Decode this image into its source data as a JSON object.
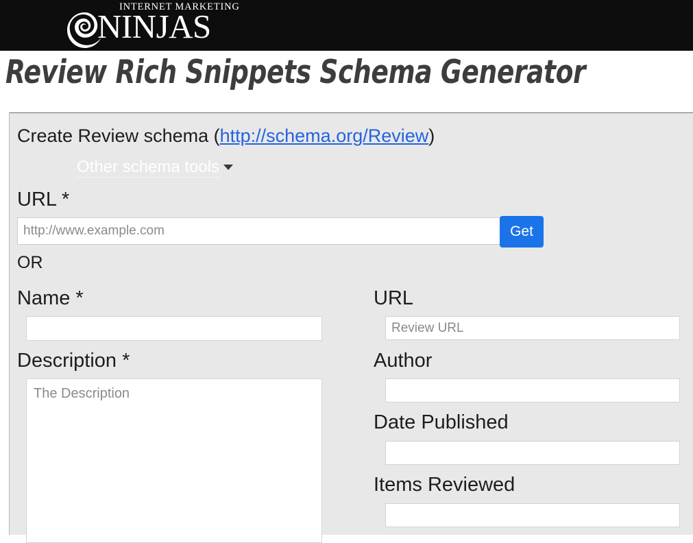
{
  "header": {
    "logo": {
      "tagline": "INTERNET MARKETING",
      "wordmark": "NINJAS",
      "mark_icon": "ninja-spiral-icon"
    }
  },
  "page": {
    "title": "Review Rich Snippets Schema Generator"
  },
  "panel": {
    "heading_prefix": "Create Review schema (",
    "heading_link": "http://schema.org/Review",
    "heading_suffix": ")",
    "other_tools_label": "Other schema tools",
    "other_tools_caret_icon": "chevron-down-icon"
  },
  "form": {
    "url_section": {
      "label": "URL *",
      "input_value": "",
      "input_placeholder": "http://www.example.com",
      "get_button_label": "Get",
      "or_text": "OR"
    },
    "left_column": [
      {
        "name": "name",
        "label": "Name *",
        "value": "",
        "placeholder": ""
      },
      {
        "name": "description",
        "label": "Description *",
        "value": "",
        "placeholder": "The Description"
      }
    ],
    "right_column": [
      {
        "name": "review-url",
        "label": "URL",
        "value": "",
        "placeholder": "Review URL"
      },
      {
        "name": "author",
        "label": "Author",
        "value": "",
        "placeholder": ""
      },
      {
        "name": "date-published",
        "label": "Date Published",
        "value": "",
        "placeholder": ""
      },
      {
        "name": "items-reviewed",
        "label": "Items Reviewed",
        "value": "",
        "placeholder": ""
      }
    ]
  },
  "colors": {
    "header_background": "#0d0d0d",
    "panel_background": "#e8e8e8",
    "accent_blue": "#1a73e8",
    "link_blue": "#2563e0",
    "title_gray": "#3d3d3d"
  }
}
